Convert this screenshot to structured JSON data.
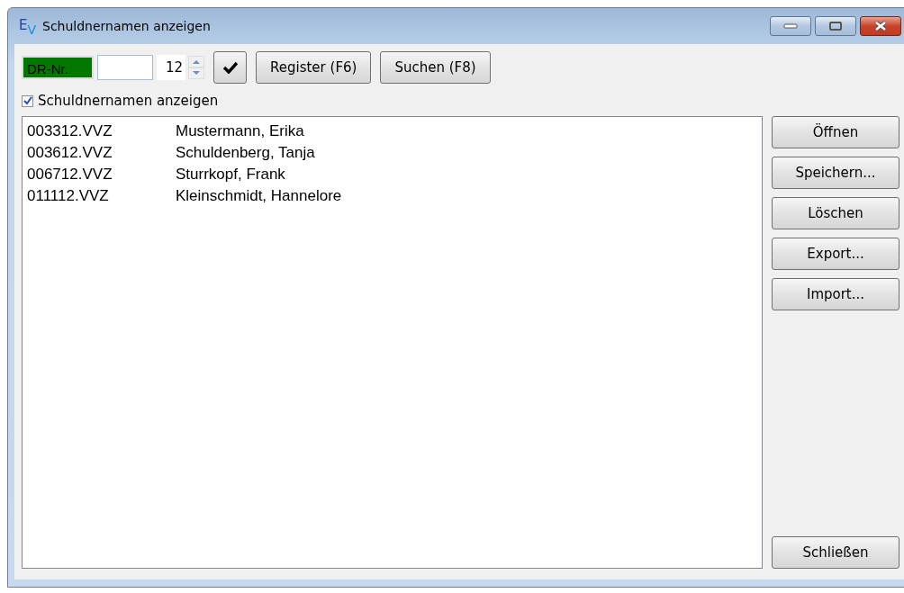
{
  "window": {
    "title": "Schuldnernamen anzeigen",
    "app_icon": {
      "letters": [
        "E",
        "V"
      ]
    }
  },
  "toolbar": {
    "label": "DR-Nr.",
    "spin": {
      "value": "12"
    },
    "buttons": [
      "Register (F6)",
      "Suchen (F8)"
    ]
  },
  "checkbox": {
    "label": "Schuldnernamen anzeigen",
    "checked": true
  },
  "list": [
    {
      "file": "003312.VVZ",
      "name": "Mustermann, Erika"
    },
    {
      "file": "003612.VVZ",
      "name": "Schuldenberg, Tanja"
    },
    {
      "file": "006712.VVZ",
      "name": "Sturrkopf, Frank"
    },
    {
      "file": "011112.VVZ",
      "name": "Kleinschmidt, Hannelore"
    }
  ],
  "side_buttons": [
    "Öffnen",
    "Speichern...",
    "Löschen",
    "Export...",
    "Import..."
  ],
  "close_button": "Schließen"
}
